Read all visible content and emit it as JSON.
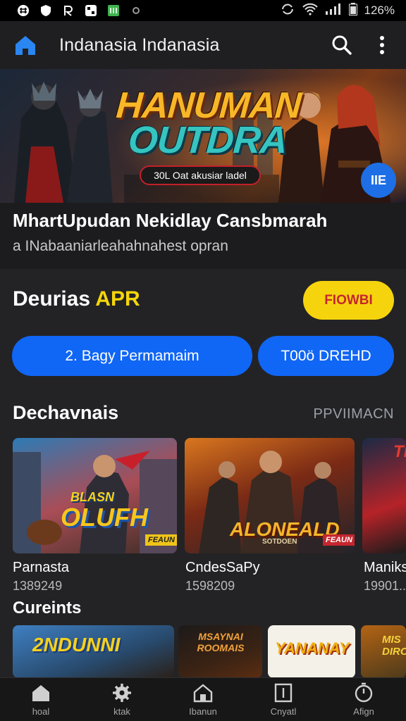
{
  "status_bar": {
    "battery": "126%"
  },
  "app_bar": {
    "title": "Indanasia Indanasia"
  },
  "hero": {
    "title_line1": "HANUMAN",
    "title_line2": "OUTDRA",
    "pill": "30L Oat akusiar ladel",
    "fab": "IIE"
  },
  "featured": {
    "title": "MhartUpudan Nekidlay Cansbmarah",
    "subtitle": "a INabaaniarleahahnahest opran"
  },
  "deals": {
    "title": "Deurias",
    "title_accent": "APR",
    "yellow_button": "FIOWBI",
    "blue_button_1": "2. Bagy Permamaim",
    "blue_button_2": "T00ö DREHD"
  },
  "section1": {
    "title": "Dechavnais",
    "link": "PPVIIMACN",
    "cards": [
      {
        "logo_top": "BLASN",
        "logo_main": "OLUFH",
        "badge": "FEAUN",
        "name": "Parnasta",
        "count": "1389249"
      },
      {
        "logo_main": "ALONEALD",
        "logo_sub": "SOTDOEN",
        "badge": "FEAUN",
        "name": "CndesSaPy",
        "count": "1598209"
      },
      {
        "logo_main": "TI",
        "name": "Maniks",
        "count": "19901..."
      }
    ]
  },
  "section2": {
    "title": "Cureints",
    "tiles": [
      {
        "text": "2NDUNNI"
      },
      {
        "text": "MSAYNAI ROOMAIS"
      },
      {
        "text": "YANANAY"
      },
      {
        "text": "MIS DIRO"
      }
    ]
  },
  "bottom_nav": {
    "items": [
      {
        "label": "hoal",
        "icon": "home-icon"
      },
      {
        "label": "ktak",
        "icon": "gear-icon"
      },
      {
        "label": "Ibanun",
        "icon": "house-icon"
      },
      {
        "label": "Cnyatl",
        "icon": "panel-icon"
      },
      {
        "label": "Afign",
        "icon": "timer-icon"
      }
    ]
  },
  "colors": {
    "accent_blue": "#1066f5",
    "accent_yellow": "#f6d40d",
    "accent_red": "#c5262f",
    "background": "#1c1c1e"
  }
}
